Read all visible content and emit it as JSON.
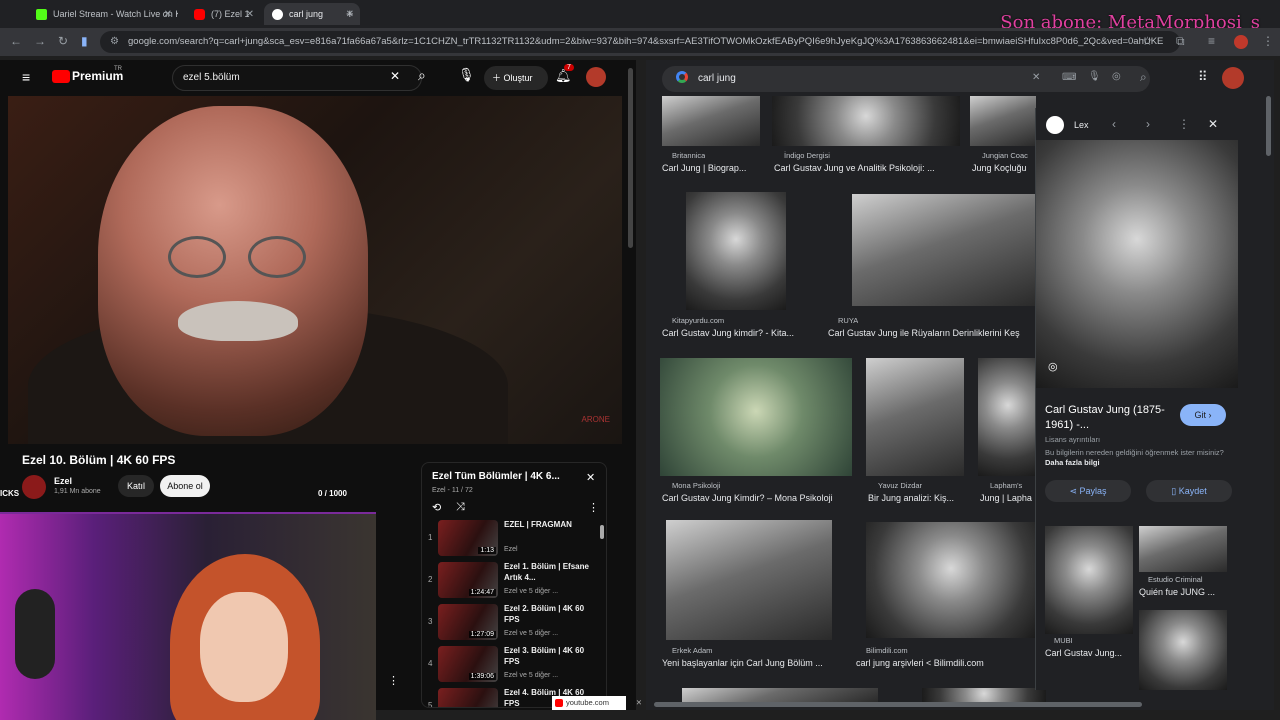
{
  "tabs": [
    {
      "label": "Uariel Stream - Watch Live on K"
    },
    {
      "label": "(7) Ezel 1"
    },
    {
      "label": "carl jung"
    }
  ],
  "address": {
    "url": "google.com/search?q=carl+jung&sca_esv=e816a71fa66a67a5&rlz=1C1CHZN_trTR1132TR1132&udm=2&biw=937&bih=974&sxsrf=AE3TifOTWOMkOzkfEAByPQI6e9hJyeKgJQ%3A1763863662481&ei=bmwiaeiSHfuIxc8P0d6_2Qc&ved=0ahUKE"
  },
  "overlay": {
    "text": "Son abone: MetaMorphosi_s"
  },
  "youtube": {
    "logo": "Premium",
    "logo_sup": "TR",
    "search_value": "ezel 5.bölüm",
    "create_label": "Oluştur",
    "notif_count": "7",
    "video_watermark": "ARONE",
    "video_title": "Ezel 10. Bölüm | 4K 60 FPS",
    "channel_name": "Ezel",
    "subscribers": "1,91 Mn abone",
    "join_label": "Katıl",
    "subscribe_label": "Abone ol",
    "counter": "0  / 1000",
    "side_label": "ICKS",
    "playlist": {
      "title": "Ezel Tüm Bölümler | 4K 6...",
      "sub": "Ezel - 11 / 72",
      "items": [
        {
          "num": "1",
          "title": "EZEL | FRAGMAN",
          "sub": "Ezel",
          "dur": "1:13"
        },
        {
          "num": "2",
          "title": "Ezel 1. Bölüm | Efsane Artık 4...",
          "sub": "Ezel ve 5 diğer ...",
          "dur": "1:24:47"
        },
        {
          "num": "3",
          "title": "Ezel 2. Bölüm | 4K 60 FPS",
          "sub": "Ezel ve 5 diğer ...",
          "dur": "1:27:09"
        },
        {
          "num": "4",
          "title": "Ezel 3. Bölüm | 4K 60 FPS",
          "sub": "Ezel ve 5 diğer ...",
          "dur": "1:39:06"
        },
        {
          "num": "5",
          "title": "Ezel 4. Bölüm | 4K 60 FPS",
          "sub": "",
          "dur": ""
        }
      ]
    },
    "status_url": "youtube.com"
  },
  "google": {
    "query": "carl jung",
    "row1": [
      {
        "src": "Britannica",
        "title": "Carl Jung | Biograp..."
      },
      {
        "src": "İndigo Dergisi",
        "title": "Carl Gustav Jung ve Analitik Psikoloji: ..."
      },
      {
        "src": "Jungian Coac",
        "title": "Jung Koçluğu"
      }
    ],
    "row2": [
      {
        "src": "Kitapyurdu.com",
        "title": "Carl Gustav Jung kimdir? - Kita..."
      },
      {
        "src": "RUYA",
        "title": "Carl Gustav Jung ile Rüyaların Derinliklerini Keş"
      }
    ],
    "row3": [
      {
        "src": "Mona Psikoloji",
        "title": "Carl Gustav Jung Kimdir? – Mona Psikoloji"
      },
      {
        "src": "Yavuz Dizdar",
        "title": "Bir Jung analizi: Kiş..."
      },
      {
        "src": "Lapham's",
        "title": "Jung | Lapha"
      }
    ],
    "row4": [
      {
        "src": "Erkek Adam",
        "title": "Yeni başlayanlar için Carl Jung Bölüm ..."
      },
      {
        "src": "Bilimdili.com",
        "title": "carl jung arşivleri < Bilimdili.com"
      }
    ],
    "side": {
      "source": "Lex",
      "title": "Carl Gustav Jung (1875-1961) -...",
      "license": "Lisans ayrıntıları",
      "info": "Bu bilgilerin nereden geldiğini öğrenmek ister misiniz?",
      "info_link": "Daha fazla bilgi",
      "go_label": "Git",
      "share_label": "Paylaş",
      "save_label": "Kaydet",
      "related": [
        {
          "src": "Estudio Criminal",
          "title": "Quién fue JUNG ..."
        },
        {
          "src": "MUBI",
          "title": "Carl Gustav Jung..."
        }
      ]
    }
  }
}
